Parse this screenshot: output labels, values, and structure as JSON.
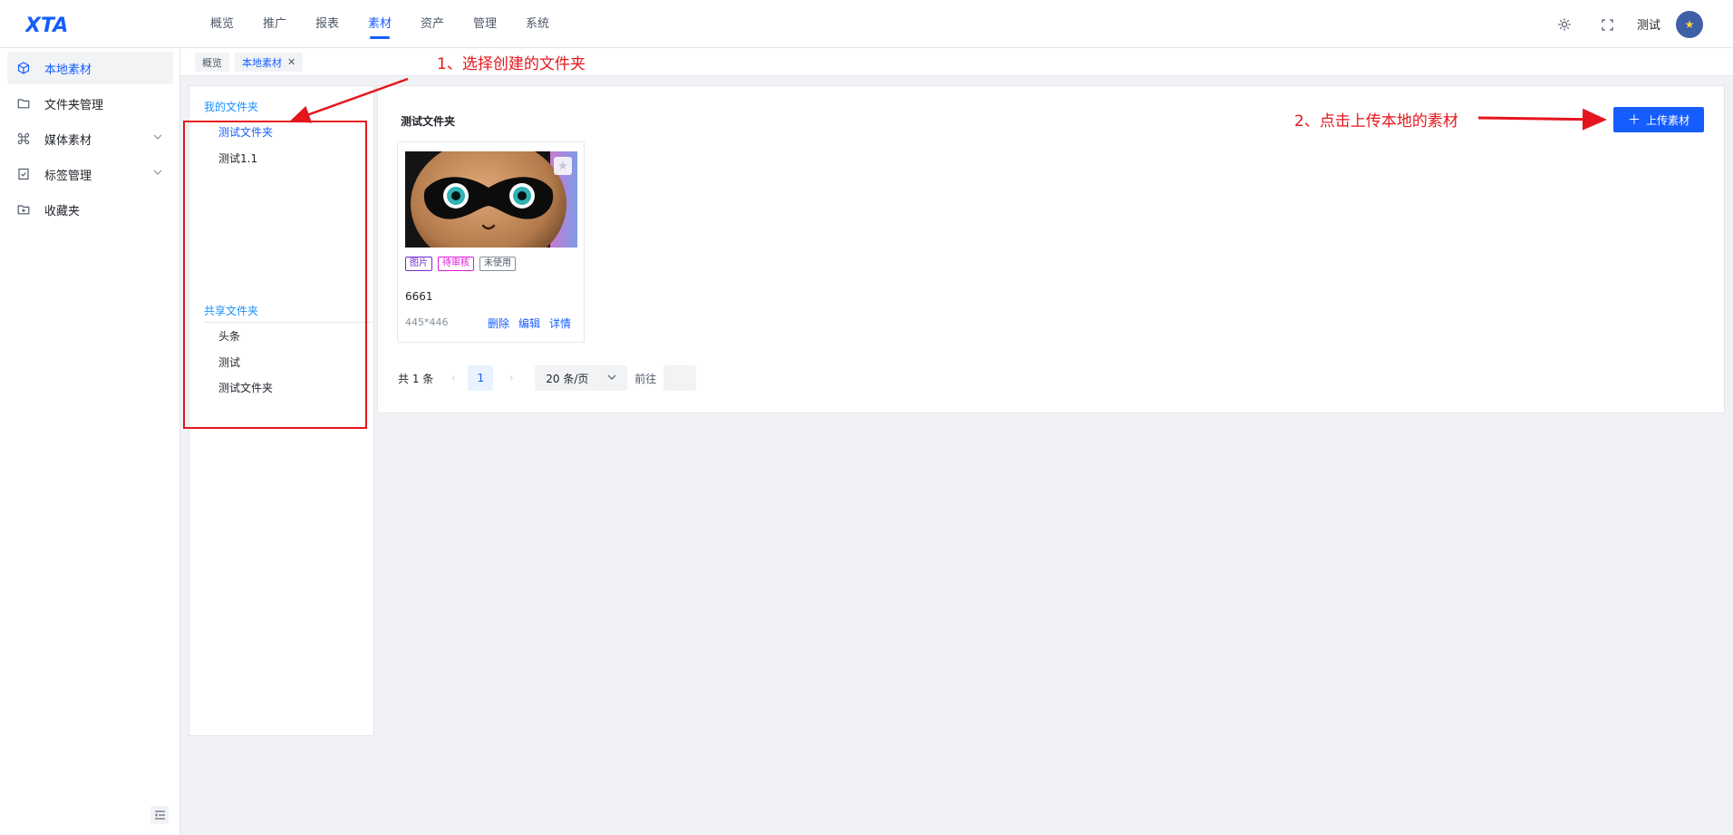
{
  "header": {
    "logo_text": "XTA",
    "nav": [
      {
        "label": "概览"
      },
      {
        "label": "推广"
      },
      {
        "label": "报表"
      },
      {
        "label": "素材",
        "active": true
      },
      {
        "label": "资产"
      },
      {
        "label": "管理"
      },
      {
        "label": "系统"
      }
    ],
    "theme_icon": "sun-icon",
    "fullscreen_icon": "fullscreen-icon",
    "user_name": "测试"
  },
  "sidebar": {
    "items": [
      {
        "label": "本地素材",
        "icon": "cube-icon",
        "active": true
      },
      {
        "label": "文件夹管理",
        "icon": "folder-icon"
      },
      {
        "label": "媒体素材",
        "icon": "command-icon",
        "expandable": true
      },
      {
        "label": "标签管理",
        "icon": "bookmark-icon",
        "expandable": true
      },
      {
        "label": "收藏夹",
        "icon": "folder-star-icon"
      }
    ],
    "collapse_icon": "menu-collapse-icon"
  },
  "tabs": [
    {
      "label": "概览"
    },
    {
      "label": "本地素材",
      "active": true,
      "closable": true
    }
  ],
  "folders": {
    "my_title": "我的文件夹",
    "my_items": [
      {
        "label": "测试文件夹",
        "selected": true
      },
      {
        "label": "测试1.1"
      }
    ],
    "shared_title": "共享文件夹",
    "shared_items": [
      {
        "label": "头条"
      },
      {
        "label": "测试"
      },
      {
        "label": "测试文件夹"
      }
    ]
  },
  "main": {
    "folder_title": "测试文件夹",
    "upload_label": "上传素材",
    "assets": [
      {
        "tags": [
          "图片",
          "待审核",
          "未使用"
        ],
        "name": "6661",
        "size": "445*446",
        "actions": [
          "删除",
          "编辑",
          "详情"
        ]
      }
    ],
    "pagination": {
      "total": "共 1 条",
      "current": "1",
      "page_size": "20 条/页",
      "goto": "前往"
    }
  },
  "annotations": {
    "step1": "1、选择创建的文件夹",
    "step2": "2、点击上传本地的素材",
    "color": "#e5151d"
  },
  "colors": {
    "primary": "#165dff",
    "folder_heading": "#1890ff"
  }
}
